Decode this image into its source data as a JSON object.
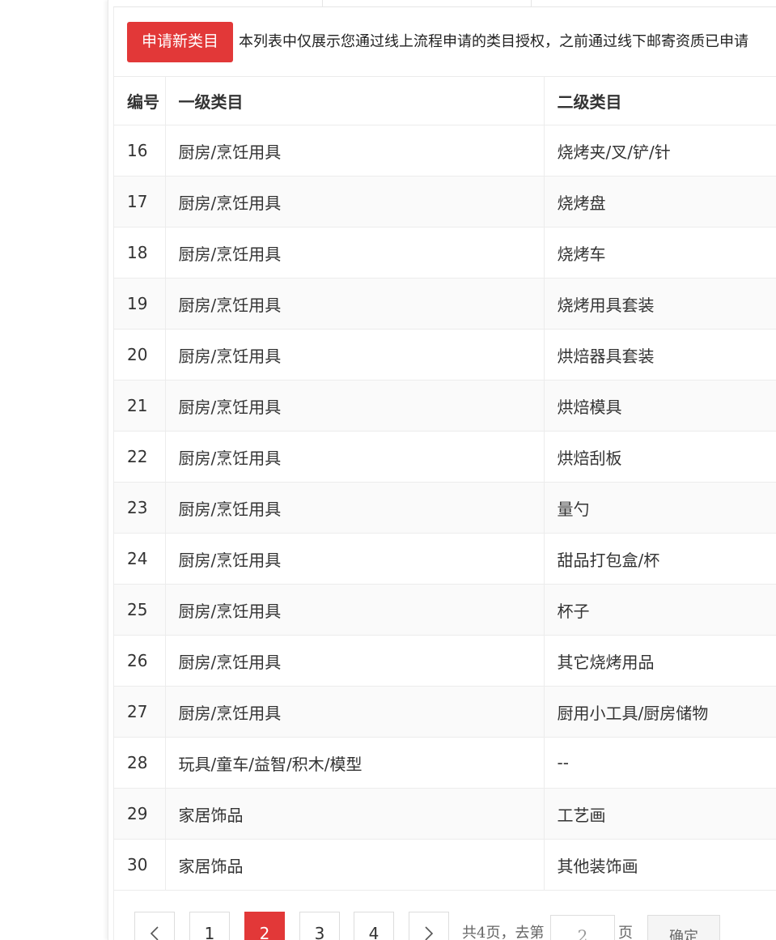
{
  "toolbar": {
    "apply_label": "申请新类目",
    "notice": "本列表中仅展示您通过线上流程申请的类目授权，之前通过线下邮寄资质已申请"
  },
  "table": {
    "columns": [
      "编号",
      "一级类目",
      "二级类目"
    ],
    "rows": [
      {
        "id": "16",
        "level1": "厨房/烹饪用具",
        "level2": "烧烤夹/叉/铲/针"
      },
      {
        "id": "17",
        "level1": "厨房/烹饪用具",
        "level2": "烧烤盘"
      },
      {
        "id": "18",
        "level1": "厨房/烹饪用具",
        "level2": "烧烤车"
      },
      {
        "id": "19",
        "level1": "厨房/烹饪用具",
        "level2": "烧烤用具套装"
      },
      {
        "id": "20",
        "level1": "厨房/烹饪用具",
        "level2": "烘焙器具套装"
      },
      {
        "id": "21",
        "level1": "厨房/烹饪用具",
        "level2": "烘焙模具"
      },
      {
        "id": "22",
        "level1": "厨房/烹饪用具",
        "level2": "烘焙刮板"
      },
      {
        "id": "23",
        "level1": "厨房/烹饪用具",
        "level2": "量勺"
      },
      {
        "id": "24",
        "level1": "厨房/烹饪用具",
        "level2": "甜品打包盒/杯"
      },
      {
        "id": "25",
        "level1": "厨房/烹饪用具",
        "level2": "杯子"
      },
      {
        "id": "26",
        "level1": "厨房/烹饪用具",
        "level2": "其它烧烤用品"
      },
      {
        "id": "27",
        "level1": "厨房/烹饪用具",
        "level2": "厨用小工具/厨房储物"
      },
      {
        "id": "28",
        "level1": "玩具/童车/益智/积木/模型",
        "level2": "--"
      },
      {
        "id": "29",
        "level1": "家居饰品",
        "level2": "工艺画"
      },
      {
        "id": "30",
        "level1": "家居饰品",
        "level2": "其他装饰画"
      }
    ]
  },
  "pager": {
    "pages": [
      "1",
      "2",
      "3",
      "4"
    ],
    "current_page": "2",
    "total_text": "共4页，去第",
    "goto_value": "2",
    "page_unit": "页",
    "confirm_label": "确定"
  },
  "icons": {
    "prev": "chevron-left-icon",
    "next": "chevron-right-icon"
  },
  "colors": {
    "accent": "#e23838",
    "border": "#ececec",
    "stripe": "#fafafa"
  }
}
